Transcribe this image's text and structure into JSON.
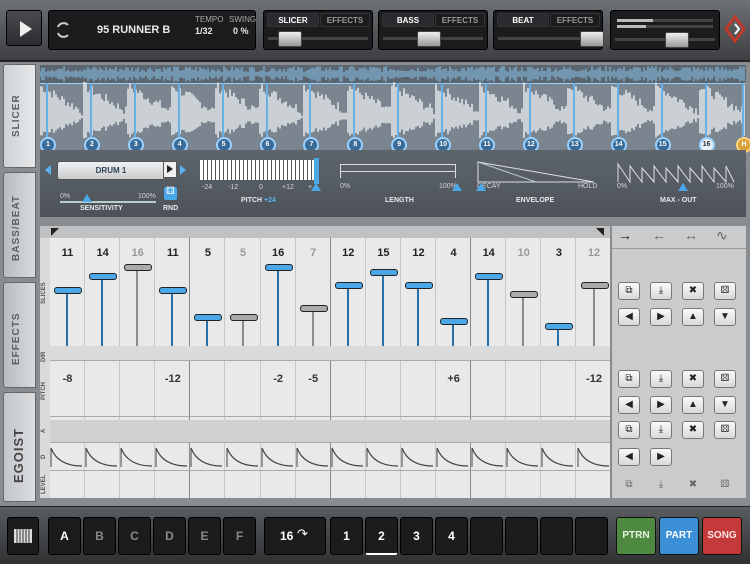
{
  "transport": {
    "play_label": ""
  },
  "song": {
    "name": "95 RUNNER B",
    "tempo_label": "TEMPO",
    "tempo": "1/32",
    "swing_label": "SWING",
    "swing": "0 %"
  },
  "modules": [
    {
      "name": "SLICER",
      "effects": "EFFECTS"
    },
    {
      "name": "BASS",
      "effects": "EFFECTS"
    },
    {
      "name": "BEAT",
      "effects": "EFFECTS"
    }
  ],
  "sidetabs": {
    "slicer": "SLICER",
    "bassbeat": "BASS/BEAT",
    "effects": "EFFECTS",
    "logo": "EGOIST"
  },
  "markers": [
    "1",
    "2",
    "3",
    "4",
    "5",
    "6",
    "7",
    "8",
    "9",
    "10",
    "11",
    "12",
    "13",
    "14",
    "15",
    "16",
    "H"
  ],
  "controls": {
    "drum": "DRUM 1",
    "sens_min": "0%",
    "sens_max": "100%",
    "sensitivity": "SENSITIVITY",
    "rnd": "RND",
    "pitch_ticks": [
      "-24",
      "-12",
      "0",
      "+12",
      "+"
    ],
    "pitch_label": "PITCH",
    "pitch_value": "+24",
    "len_min": "0%",
    "len_max": "100%",
    "length": "LENGTH",
    "env_left": "DECAY",
    "env_right": "HOLD",
    "envelope": "ENVELOPE",
    "max_min": "0%",
    "max_max": "100%",
    "maxout": "MAX - OUT"
  },
  "row_labels": {
    "slices": "SLICES",
    "dir": "DIR",
    "pitch": "PITCH",
    "a": "A",
    "d": "D",
    "level": "LEVEL"
  },
  "steps": {
    "slices": [
      11,
      14,
      16,
      11,
      5,
      5,
      16,
      7,
      12,
      15,
      12,
      4,
      14,
      10,
      3,
      12
    ],
    "active": [
      true,
      true,
      false,
      true,
      true,
      false,
      true,
      false,
      true,
      true,
      true,
      true,
      true,
      false,
      true,
      false
    ],
    "pitch": [
      "-8",
      "",
      "",
      "-12",
      "",
      "",
      "-2",
      "-5",
      "",
      "",
      "",
      "+6",
      "",
      "",
      "",
      "-12"
    ]
  },
  "directions": {
    "forward": "→",
    "reverse": "←",
    "pingpong": "↔",
    "random": "∿"
  },
  "tools": {
    "copy": "⧉",
    "paste": "⤓",
    "clear": "✖",
    "dice": "⚄",
    "left": "◀",
    "right": "▶",
    "up": "▲",
    "down": "▼"
  },
  "patterns": [
    "A",
    "B",
    "C",
    "D",
    "E",
    "F"
  ],
  "pattern_length": "16",
  "parts": [
    "1",
    "2",
    "3",
    "4"
  ],
  "modes": {
    "ptrn": "PTRN",
    "part": "PART",
    "song": "SONG"
  },
  "colors": {
    "accent": "#4aa8e8",
    "ptrn": "#4d8a3f",
    "part": "#3b8fd6",
    "song": "#c43a3a"
  }
}
